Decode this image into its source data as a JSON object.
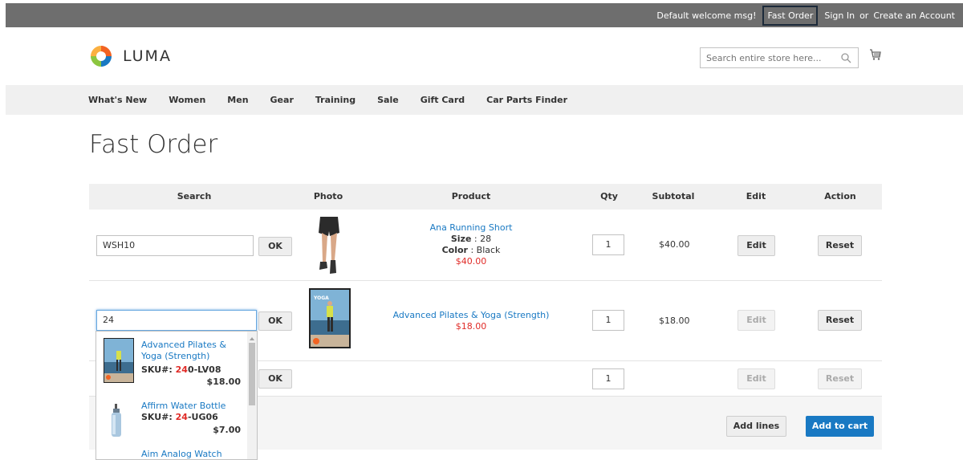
{
  "header": {
    "welcome": "Default welcome msg!",
    "fast_order": "Fast Order",
    "sign_in": "Sign In",
    "or": "or",
    "create_account": "Create an Account"
  },
  "logo": {
    "text": "LUMA"
  },
  "search": {
    "placeholder": "Search entire store here..."
  },
  "nav": {
    "items": [
      "What's New",
      "Women",
      "Men",
      "Gear",
      "Training",
      "Sale",
      "Gift Card",
      "Car Parts Finder"
    ]
  },
  "page": {
    "title": "Fast Order"
  },
  "table": {
    "headers": {
      "search": "Search",
      "photo": "Photo",
      "product": "Product",
      "qty": "Qty",
      "subtotal": "Subtotal",
      "edit": "Edit",
      "action": "Action"
    },
    "rows": [
      {
        "search_value": "WSH10",
        "ok_label": "OK",
        "product_name": "Ana Running Short",
        "size_label": "Size",
        "size_value": " : 28",
        "color_label": "Color",
        "color_value": " : Black",
        "price": "$40.00",
        "qty": "1",
        "subtotal": "$40.00",
        "edit_label": "Edit",
        "reset_label": "Reset"
      },
      {
        "search_value": "24",
        "ok_label": "OK",
        "product_name": "Advanced Pilates & Yoga (Strength)",
        "price": "$18.00",
        "qty": "1",
        "subtotal": "$18.00",
        "edit_label": "Edit",
        "reset_label": "Reset"
      },
      {
        "search_value": "",
        "ok_label": "OK",
        "qty": "1",
        "edit_label": "Edit",
        "reset_label": "Reset"
      }
    ]
  },
  "footer": {
    "add_lines": "Add lines",
    "add_to_cart": "Add to cart"
  },
  "dropdown": {
    "items": [
      {
        "name": "Advanced Pilates & Yoga (Strength)",
        "sku_label": "SKU#: ",
        "sku_match": "24",
        "sku_rest": "0-LV08",
        "price": "$18.00"
      },
      {
        "name": "Affirm Water Bottle",
        "sku_label": "SKU#: ",
        "sku_match": "24",
        "sku_rest": "-UG06",
        "price": "$7.00"
      },
      {
        "name": "Aim Analog Watch"
      }
    ]
  },
  "colors": {
    "accent": "#1979c3",
    "price": "#e02b27",
    "topbar": "#6e6e6e"
  }
}
